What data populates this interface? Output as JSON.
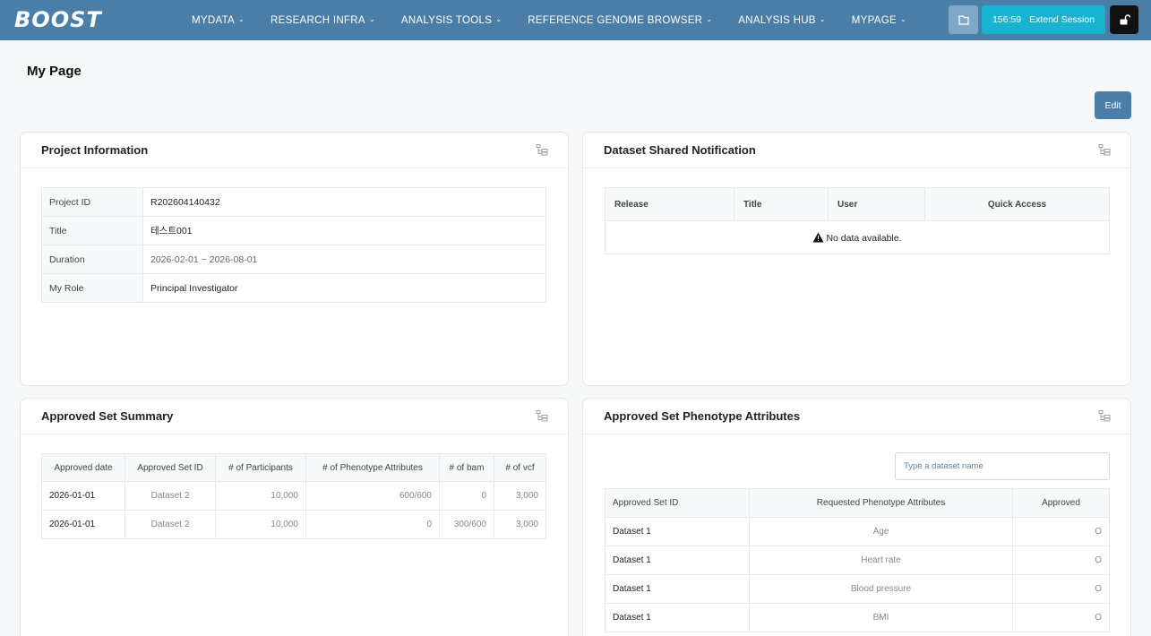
{
  "navbar": {
    "logo": "BOOST",
    "menu": [
      {
        "label": "MYDATA"
      },
      {
        "label": "RESEARCH INFRA"
      },
      {
        "label": "ANALYSIS TOOLS"
      },
      {
        "label": "REFERENCE GENOME BROWSER"
      },
      {
        "label": "ANALYSIS HUB"
      },
      {
        "label": "MYPAGE"
      }
    ],
    "session_time": "156:59",
    "extend_label": "Extend Session"
  },
  "page": {
    "title": "My Page",
    "edit_label": "Edit"
  },
  "project_info": {
    "title": "Project Information",
    "rows": [
      {
        "key": "Project ID",
        "value": "R202604140432"
      },
      {
        "key": "Title",
        "value": "테스트001"
      },
      {
        "key": "Duration",
        "value": "2026-02-01 ~ 2026-08-01"
      },
      {
        "key": "My Role",
        "value": "Principal Investigator"
      }
    ]
  },
  "dataset_notification": {
    "title": "Dataset Shared Notification",
    "columns": [
      "Release",
      "Title",
      "User",
      "Quick Access"
    ],
    "empty_text": "No data available."
  },
  "approved_summary": {
    "title": "Approved Set Summary",
    "columns": [
      "Approved date",
      "Approved Set ID",
      "# of Participants",
      "# of Phenotype Attributes",
      "# of bam",
      "# of vcf"
    ],
    "rows": [
      [
        "2026-01-01",
        "Dataset 2",
        "10,000",
        "600/600",
        "0",
        "3,000"
      ],
      [
        "2026-01-01",
        "Dataset 2",
        "10,000",
        "0",
        "300/600",
        "3,000"
      ]
    ]
  },
  "phenotype_attributes": {
    "title": "Approved Set Phenotype Attributes",
    "search_placeholder": "Type a dataset name",
    "columns": [
      "Approved Set ID",
      "Requested Phenotype Attributes",
      "Approved"
    ],
    "rows": [
      [
        "Dataset 1",
        "Age",
        "O"
      ],
      [
        "Dataset 1",
        "Heart rate",
        "O"
      ],
      [
        "Dataset 1",
        "Blood pressure",
        "O"
      ],
      [
        "Dataset 1",
        "BMI",
        "O"
      ]
    ]
  },
  "colors": {
    "navbar": "#4a7ea6",
    "session": "#17b3d1",
    "lock": "#111111"
  }
}
